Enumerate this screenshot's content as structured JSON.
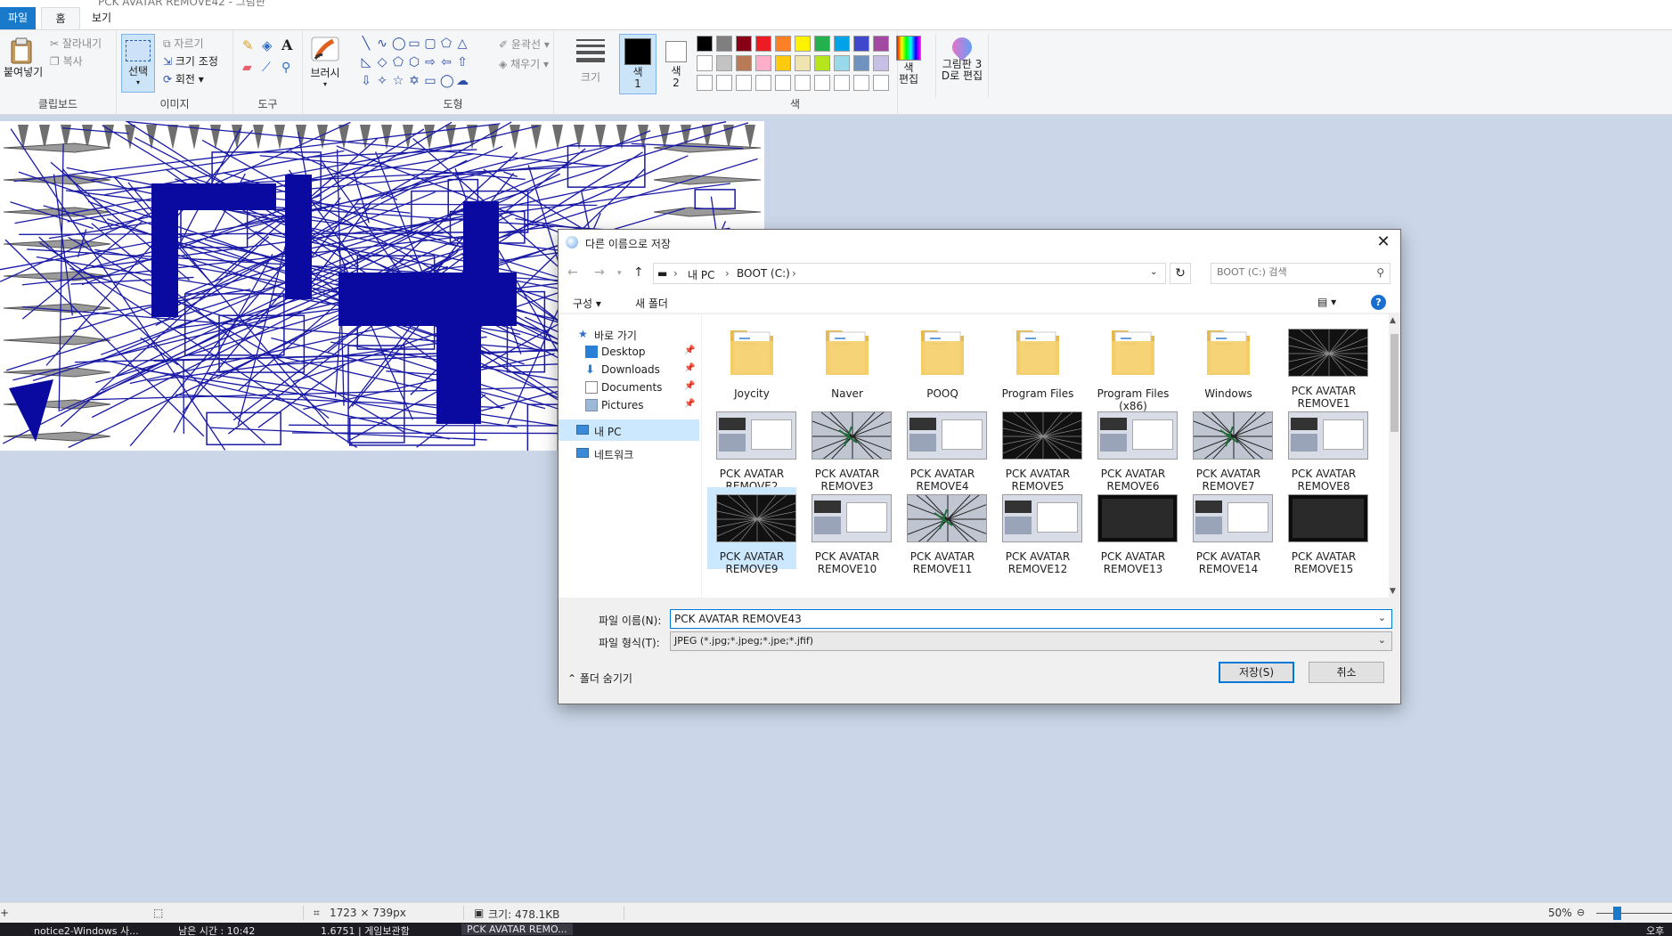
{
  "window": {
    "title": "PCK AVATAR REMOVE42 - 그림판"
  },
  "tabs": {
    "file": "파일",
    "home": "홈",
    "view": "보기"
  },
  "ribbon": {
    "clipboard": {
      "paste": "붙여넣기",
      "cut": "잘라내기",
      "copy": "복사",
      "group": "클립보드"
    },
    "image": {
      "select": "선택",
      "crop": "자르기",
      "resize": "크기 조정",
      "rotate": "회전",
      "group": "이미지"
    },
    "tools": {
      "group": "도구"
    },
    "brushes": {
      "label": "브러시"
    },
    "shapes": {
      "outline": "윤곽선",
      "fill": "채우기",
      "group": "도형"
    },
    "size": {
      "label": "크기"
    },
    "color1": {
      "label": "색\n1"
    },
    "color2": {
      "label": "색\n2"
    },
    "colors": {
      "group": "색",
      "row1": [
        "#000000",
        "#7f7f7f",
        "#880015",
        "#ed1c24",
        "#ff7f27",
        "#fff200",
        "#22b14c",
        "#00a2e8",
        "#3f48cc",
        "#a349a4"
      ],
      "row2": [
        "#ffffff",
        "#c3c3c3",
        "#b97a57",
        "#ffaec9",
        "#ffc90e",
        "#efe4b0",
        "#b5e61d",
        "#99d9ea",
        "#7092be",
        "#c8bfe7"
      ]
    },
    "edit_colors": {
      "label": "색\n편집"
    },
    "paint3d": {
      "label": "그림판 3\nD로 편집"
    }
  },
  "dialog": {
    "title": "다른 이름으로 저장",
    "breadcrumb": [
      "내 PC",
      "BOOT (C:)"
    ],
    "search_placeholder": "BOOT (C:) 검색",
    "organize": "구성",
    "new_folder": "새 폴더",
    "nav": {
      "quick_access": "바로 가기",
      "items": [
        "Desktop",
        "Downloads",
        "Documents",
        "Pictures"
      ],
      "this_pc": "내 PC",
      "network": "네트워크"
    },
    "files": [
      {
        "name": "Joycity",
        "kind": "folder"
      },
      {
        "name": "Naver",
        "kind": "folder"
      },
      {
        "name": "POOQ",
        "kind": "folder"
      },
      {
        "name": "Program Files",
        "kind": "folder"
      },
      {
        "name": "Program Files (x86)",
        "kind": "folder"
      },
      {
        "name": "Windows",
        "kind": "folder"
      },
      {
        "name": "PCK AVATAR REMOVE1",
        "kind": "dark"
      },
      {
        "name": "PCK AVATAR REMOVE2",
        "kind": "window"
      },
      {
        "name": "PCK AVATAR REMOVE3",
        "kind": "scribble"
      },
      {
        "name": "PCK AVATAR REMOVE4",
        "kind": "window"
      },
      {
        "name": "PCK AVATAR REMOVE5",
        "kind": "dark"
      },
      {
        "name": "PCK AVATAR REMOVE6",
        "kind": "window"
      },
      {
        "name": "PCK AVATAR REMOVE7",
        "kind": "scribble"
      },
      {
        "name": "PCK AVATAR REMOVE8",
        "kind": "window"
      },
      {
        "name": "PCK AVATAR REMOVE9",
        "kind": "dark"
      },
      {
        "name": "PCK AVATAR REMOVE10",
        "kind": "window"
      },
      {
        "name": "PCK AVATAR REMOVE11",
        "kind": "scribble"
      },
      {
        "name": "PCK AVATAR REMOVE12",
        "kind": "window"
      },
      {
        "name": "PCK AVATAR REMOVE13",
        "kind": "black"
      },
      {
        "name": "PCK AVATAR REMOVE14",
        "kind": "window"
      },
      {
        "name": "PCK AVATAR REMOVE15",
        "kind": "black"
      }
    ],
    "filename_label": "파일 이름(N):",
    "filename_value": "PCK AVATAR REMOVE43",
    "filetype_label": "파일 형식(T):",
    "filetype_value": "JPEG (*.jpg;*.jpeg;*.jpe;*.jfif)",
    "hide_folders": "폴더 숨기기",
    "save": "저장(S)",
    "cancel": "취소"
  },
  "status": {
    "dimensions": "1723 × 739px",
    "size": "크기: 478.1KB",
    "zoom": "50%"
  },
  "taskbar": {
    "items": [
      "notice2-Windows 사...",
      "남은 시간 : 10:42",
      "1.6751 | 게임보관함",
      "PCK AVATAR REMO..."
    ],
    "tray": "오후"
  }
}
